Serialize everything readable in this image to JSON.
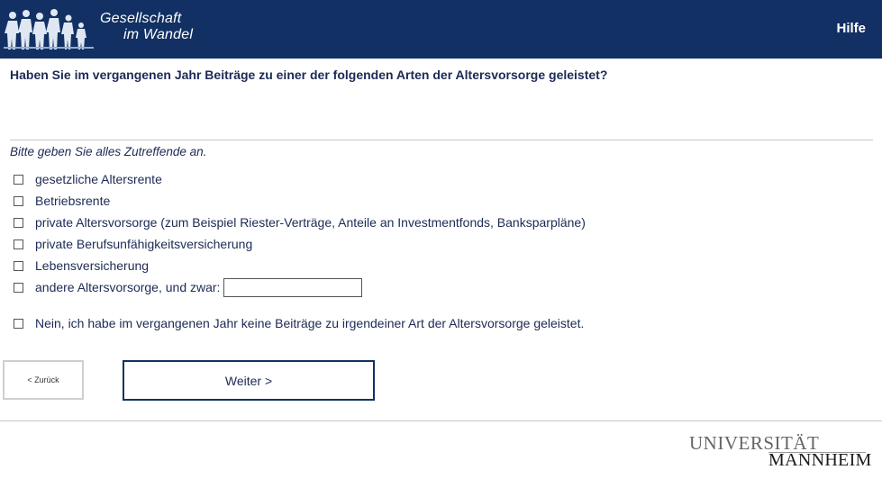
{
  "header": {
    "logo_line1": "Gesellschaft",
    "logo_line2": "im Wandel",
    "help_label": "Hilfe",
    "background_color": "#123063"
  },
  "question": "Haben Sie im vergangenen Jahr Beiträge zu einer der folgenden Arten der Altersvorsorge geleistet?",
  "instruction": "Bitte geben Sie alles Zutreffende an.",
  "options": [
    {
      "label": "gesetzliche Altersrente",
      "checked": false
    },
    {
      "label": "Betriebsrente",
      "checked": false
    },
    {
      "label": "private Altersvorsorge (zum Beispiel Riester-Verträge, Anteile an Investmentfonds, Banksparpläne)",
      "checked": false
    },
    {
      "label": "private Berufsunfähigkeitsversicherung",
      "checked": false
    },
    {
      "label": "Lebensversicherung",
      "checked": false
    },
    {
      "label": "andere Altersvorsorge, und zwar:",
      "checked": false,
      "input_value": ""
    }
  ],
  "none_option": {
    "label": "Nein, ich habe im vergangenen Jahr keine Beiträge zu irgendeiner Art der Altersvorsorge geleistet.",
    "checked": false
  },
  "nav": {
    "back_label": "< Zurück",
    "next_label": "Weiter >"
  },
  "university_logo": {
    "line1": "UNIVERSITÄT",
    "line2": "MANNHEIM"
  }
}
